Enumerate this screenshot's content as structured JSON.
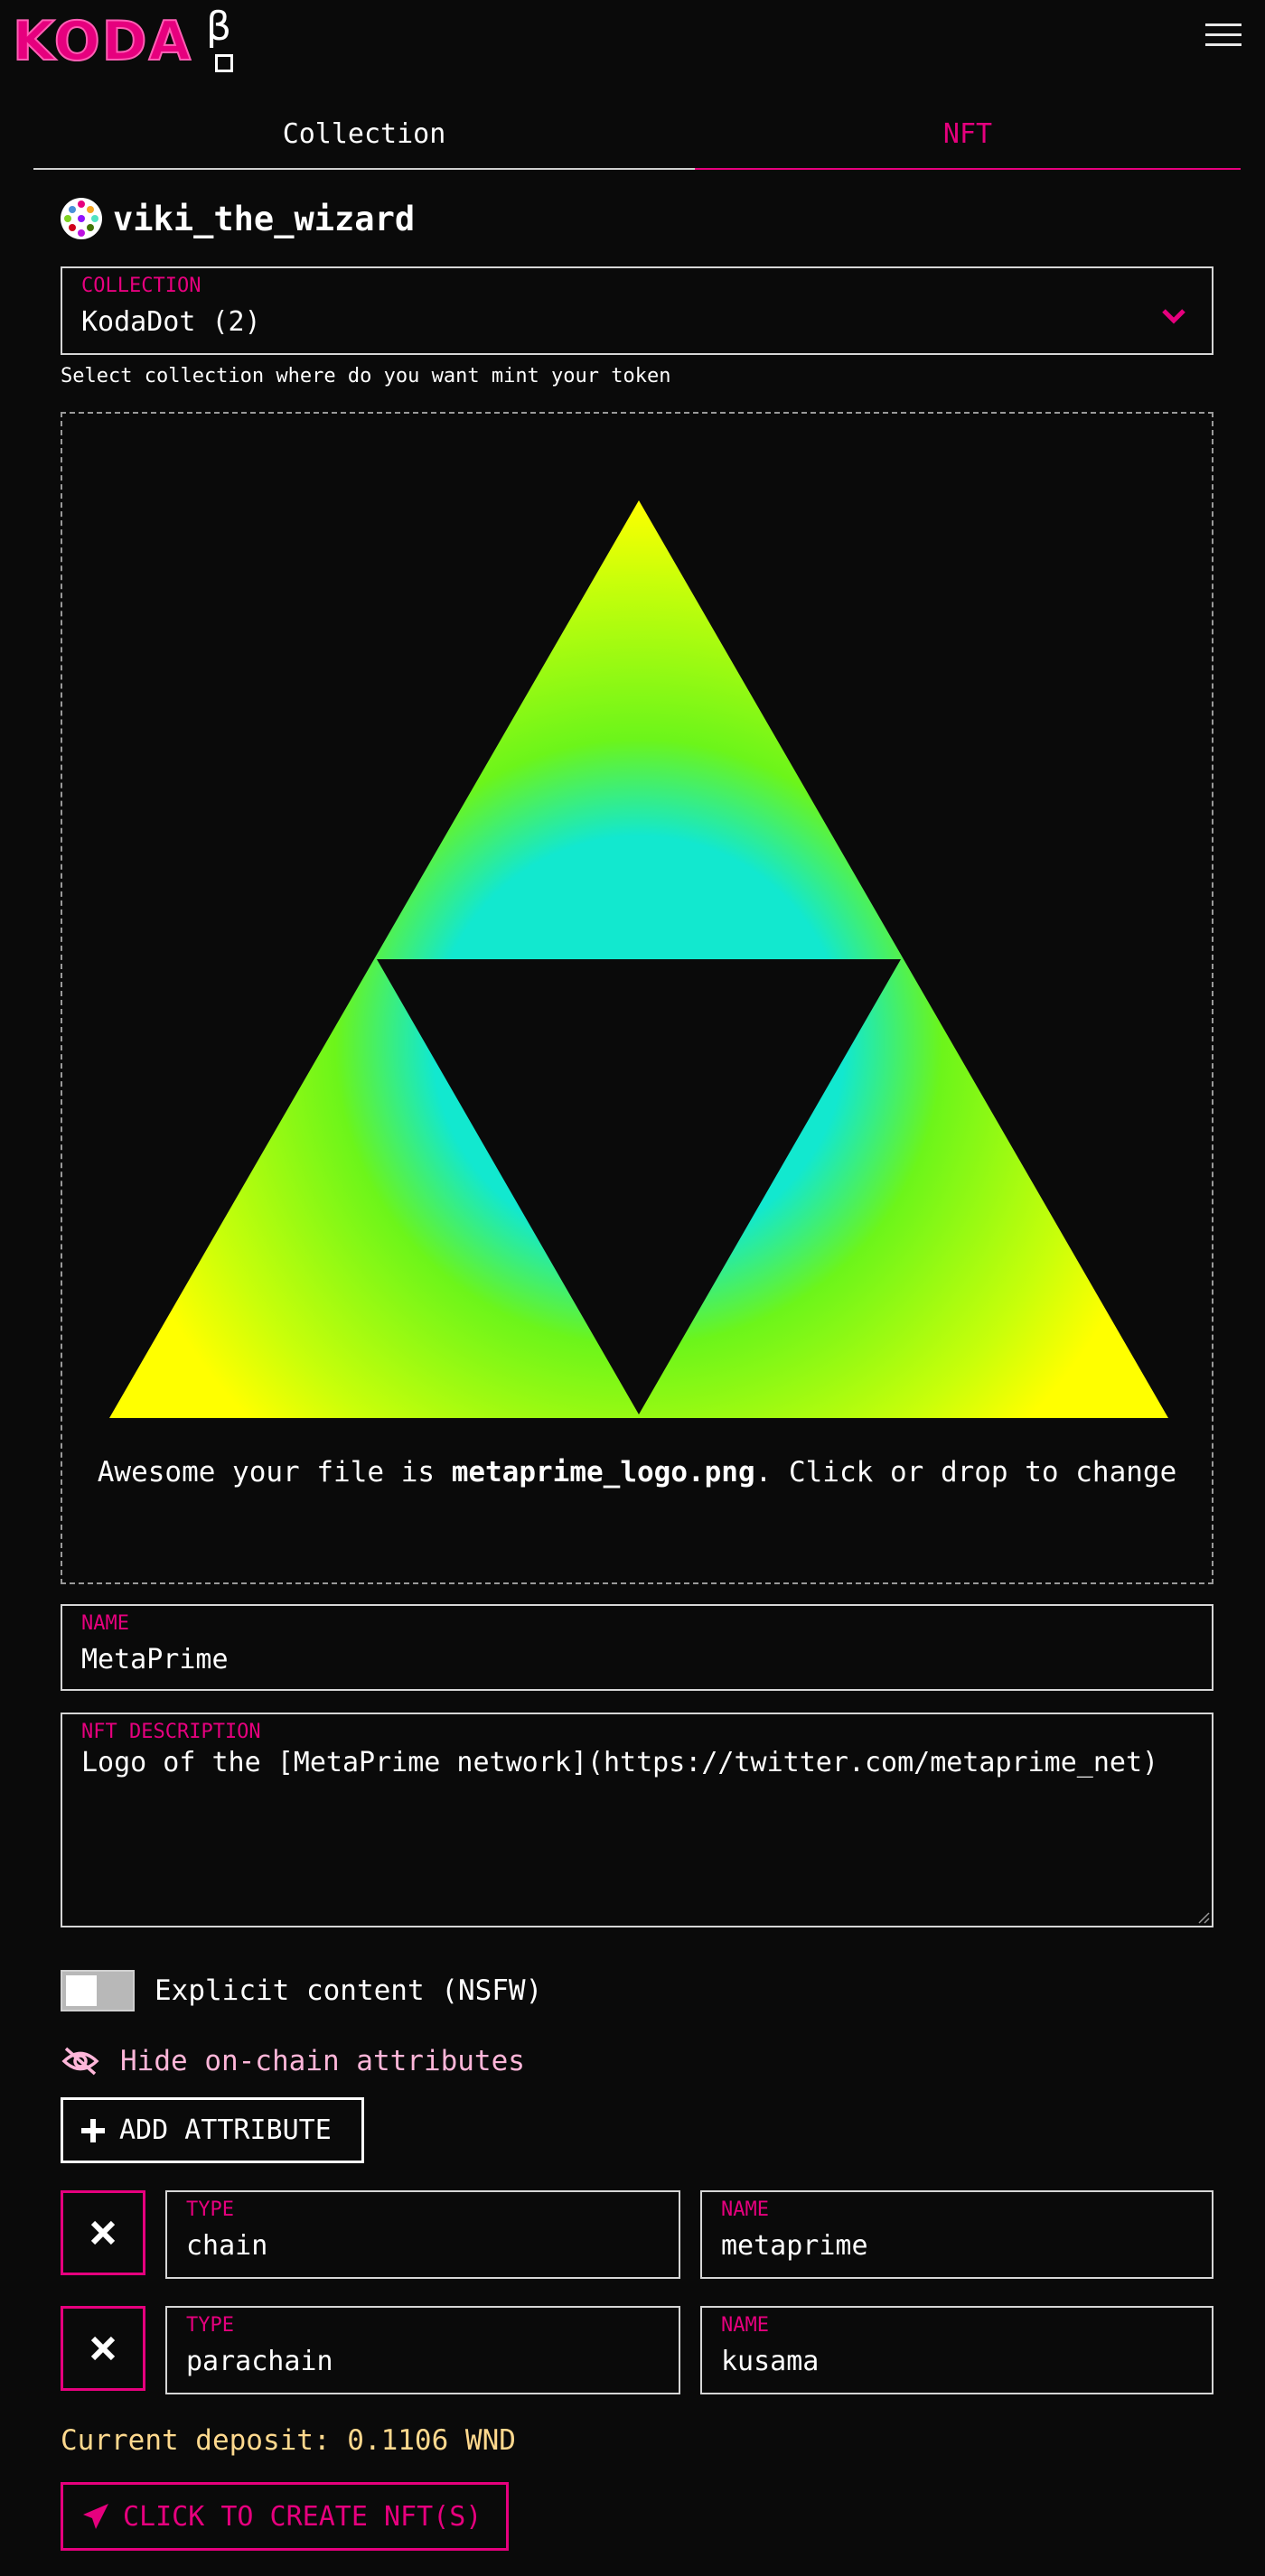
{
  "header": {
    "logo_text": "KODA",
    "logo_beta": "β",
    "menu_icon": "hamburger-menu-icon"
  },
  "tabs": [
    {
      "label": "Collection",
      "active": false
    },
    {
      "label": "NFT",
      "active": true
    }
  ],
  "account": {
    "name": "viki_the_wizard"
  },
  "collection_select": {
    "label": "COLLECTION",
    "value": "KodaDot (2)",
    "hint": "Select collection where do you want mint your token"
  },
  "dropzone": {
    "text_prefix": "Awesome your file is ",
    "file_name": "metaprime_logo.png",
    "text_suffix": ". Click or drop to change"
  },
  "name_field": {
    "label": "NAME",
    "value": "MetaPrime"
  },
  "description_field": {
    "label": "NFT DESCRIPTION",
    "value": "Logo of the [MetaPrime network](https://twitter.com/metaprime_net)"
  },
  "nsfw": {
    "label": "Explicit content (NSFW)",
    "checked": false
  },
  "hide_attributes": {
    "label": "Hide on-chain attributes"
  },
  "add_attribute": {
    "label": "ADD ATTRIBUTE"
  },
  "attributes": [
    {
      "type_label": "TYPE",
      "type_value": "chain",
      "name_label": "NAME",
      "name_value": "metaprime"
    },
    {
      "type_label": "TYPE",
      "type_value": "parachain",
      "name_label": "NAME",
      "name_value": "kusama"
    }
  ],
  "deposit": {
    "text": "Current deposit: 0.1106 WND"
  },
  "create_button": {
    "label": "CLICK TO CREATE NFT(S)"
  },
  "colors": {
    "accent": "#e6007e",
    "deposit": "#ffd98e",
    "background": "#0a0a0a"
  }
}
